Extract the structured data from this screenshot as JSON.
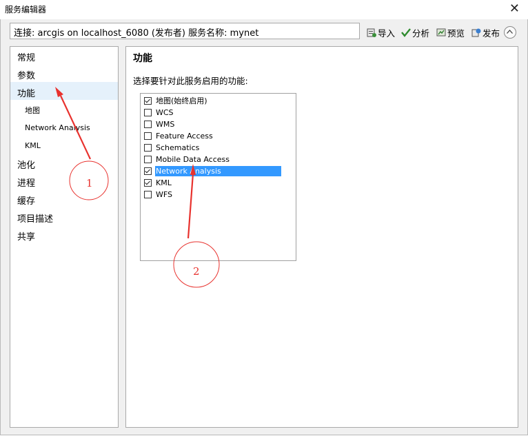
{
  "window": {
    "title": "服务编辑器",
    "close_glyph": "✕"
  },
  "connection": {
    "text": "连接: arcgis on localhost_6080 (发布者)    服务名称: mynet"
  },
  "toolbar": {
    "import_label": "导入",
    "analyze_label": "分析",
    "preview_label": "预览",
    "publish_label": "发布"
  },
  "nav": {
    "items": [
      {
        "label": "常规"
      },
      {
        "label": "参数"
      },
      {
        "label": "功能"
      },
      {
        "label": "地图"
      },
      {
        "label": "Network Analysis"
      },
      {
        "label": "KML"
      },
      {
        "label": "池化"
      },
      {
        "label": "进程"
      },
      {
        "label": "缓存"
      },
      {
        "label": "项目描述"
      },
      {
        "label": "共享"
      }
    ],
    "selected": "功能"
  },
  "main": {
    "heading": "功能",
    "instruction": "选择要针对此服务启用的功能:",
    "capabilities": [
      {
        "label": "地图(始终启用)",
        "checked": true
      },
      {
        "label": "WCS",
        "checked": false
      },
      {
        "label": "WMS",
        "checked": false
      },
      {
        "label": "Feature Access",
        "checked": false
      },
      {
        "label": "Schematics",
        "checked": false
      },
      {
        "label": "Mobile Data Access",
        "checked": false
      },
      {
        "label": "Network Analysis",
        "checked": true,
        "highlighted": true
      },
      {
        "label": "KML",
        "checked": true
      },
      {
        "label": "WFS",
        "checked": false
      }
    ]
  },
  "annotations": {
    "marker_1": "1",
    "marker_2": "2"
  },
  "colors": {
    "selection_blue": "#3399ff",
    "nav_selected_bg": "#e5f1fb",
    "annotation_red": "#e8322e"
  }
}
